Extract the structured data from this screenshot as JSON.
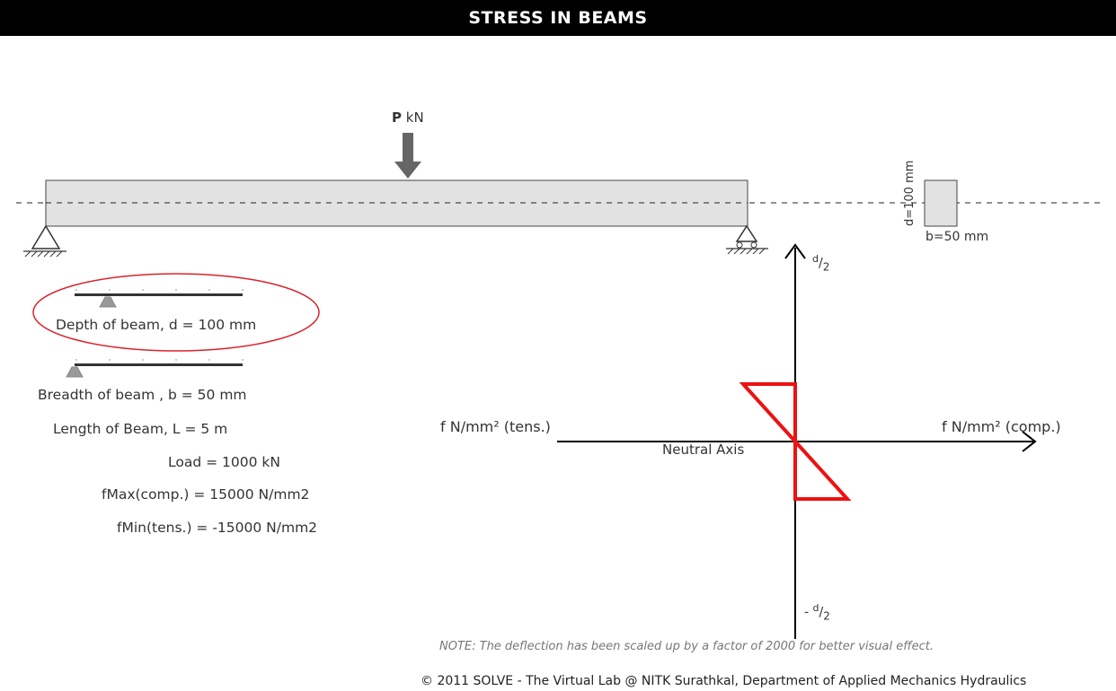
{
  "header": {
    "title": "STRESS IN BEAMS"
  },
  "load": {
    "symbol": "P",
    "unit": "kN"
  },
  "section": {
    "depth_label": "d=100 mm",
    "breadth_label": "b=50 mm"
  },
  "sliders": {
    "depth": {
      "label": "Depth of beam, d =  100 mm",
      "fraction": 0.2
    },
    "breadth": {
      "label": "Breadth of beam , b = 50 mm",
      "fraction": 0.0
    }
  },
  "params": {
    "length": "Length of Beam, L = 5 m",
    "load": "Load = 1000 kN",
    "fmax": "fMax(comp.) =  15000 N/mm2",
    "fmin": "fMin(tens.) = -15000 N/mm2"
  },
  "diagram": {
    "top_label_num": "d",
    "top_label_den": "2",
    "bottom_label_prefix": "- ",
    "bottom_label_num": "d",
    "bottom_label_den": "2",
    "left_label": "f N/mm² (tens.)",
    "right_label": "f N/mm² (comp.)",
    "axis_label": "Neutral Axis",
    "stress_color": "#ee1111"
  },
  "note": "NOTE: The deflection has been scaled up by a factor of 2000 for better visual effect.",
  "footer": "© 2011 SOLVE - The Virtual Lab @ NITK Surathkal, Department of Applied Mechanics Hydraulics",
  "colors": {
    "highlight_ellipse": "#d9232a",
    "beam_fill": "#e2e2e2",
    "arrow": "#666666"
  }
}
